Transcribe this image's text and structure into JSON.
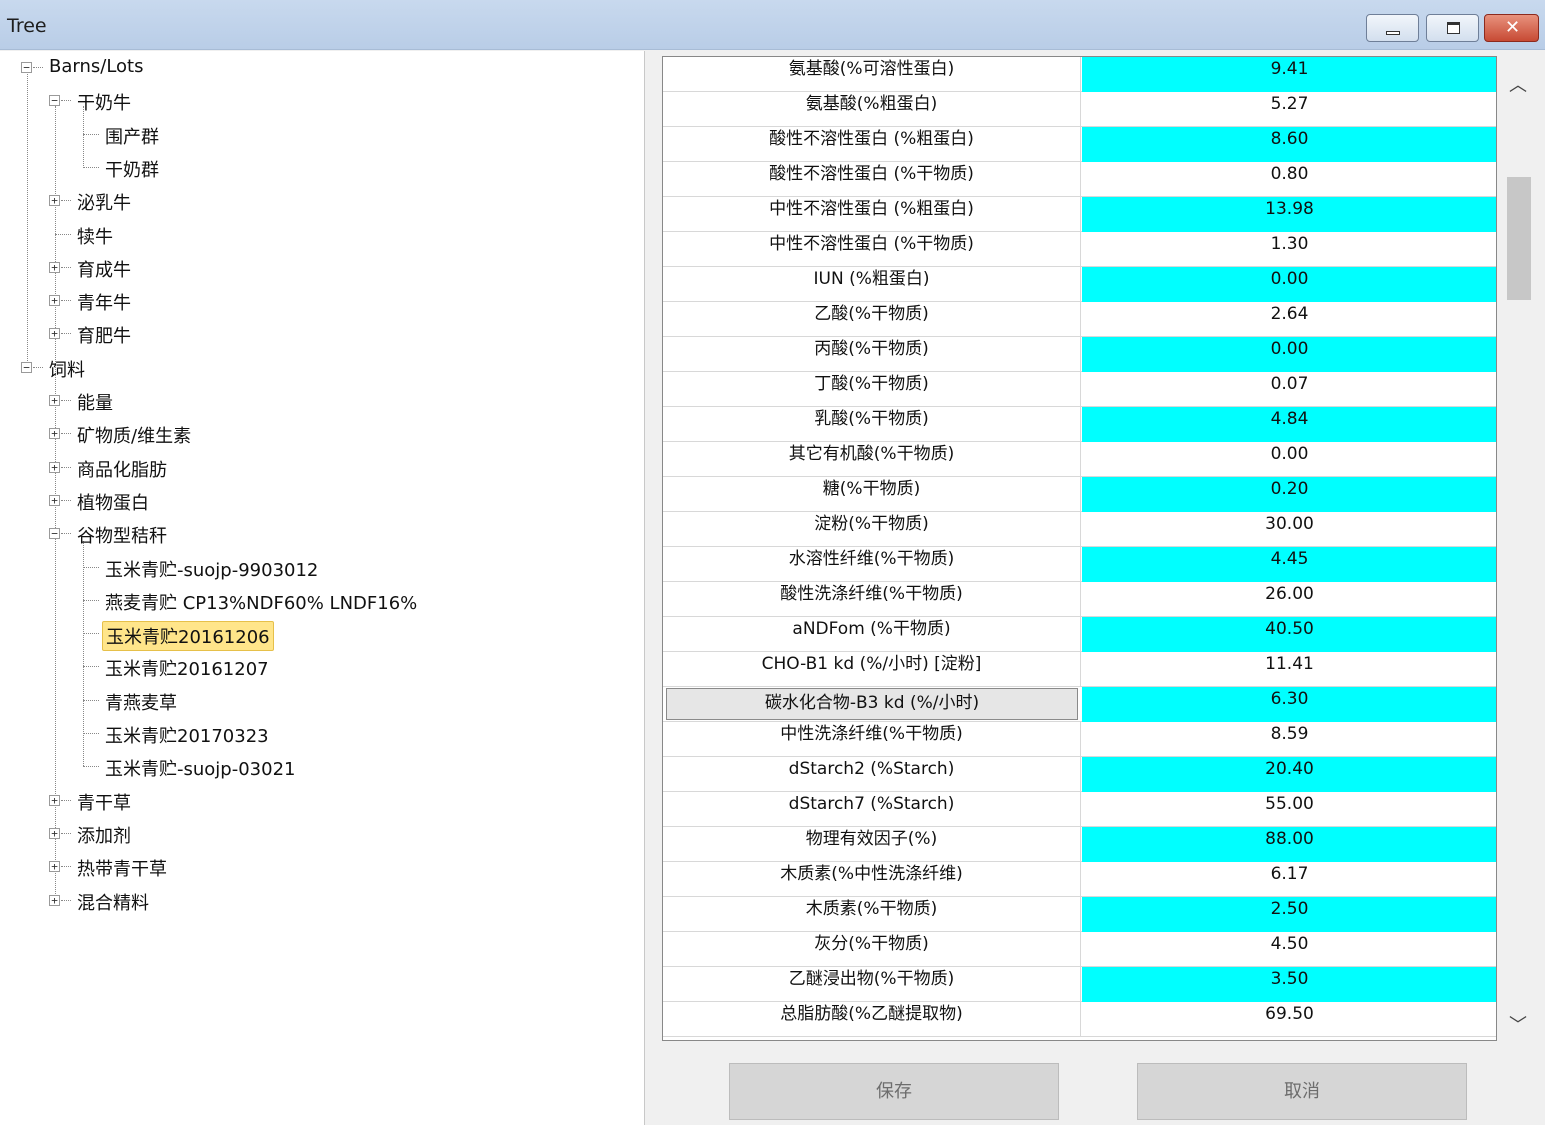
{
  "window": {
    "title": "Tree"
  },
  "tree": {
    "nodes": [
      {
        "label": "Barns/Lots",
        "expander": "−"
      },
      {
        "label": "干奶牛",
        "expander": "−"
      },
      {
        "label": "围产群"
      },
      {
        "label": "干奶群"
      },
      {
        "label": "泌乳牛",
        "expander": "+"
      },
      {
        "label": "犊牛"
      },
      {
        "label": "育成牛",
        "expander": "+"
      },
      {
        "label": "青年牛",
        "expander": "+"
      },
      {
        "label": "育肥牛",
        "expander": "+"
      },
      {
        "label": "饲料",
        "expander": "−"
      },
      {
        "label": "能量",
        "expander": "+"
      },
      {
        "label": "矿物质/维生素",
        "expander": "+"
      },
      {
        "label": "商品化脂肪",
        "expander": "+"
      },
      {
        "label": "植物蛋白",
        "expander": "+"
      },
      {
        "label": "谷物型秸秆",
        "expander": "−"
      },
      {
        "label": "玉米青贮-suojp-9903012"
      },
      {
        "label": "燕麦青贮 CP13%NDF60% LNDF16%"
      },
      {
        "label": "玉米青贮20161206",
        "selected": true
      },
      {
        "label": "玉米青贮20161207"
      },
      {
        "label": "青燕麦草"
      },
      {
        "label": "玉米青贮20170323"
      },
      {
        "label": "玉米青贮-suojp-03021"
      },
      {
        "label": "青干草",
        "expander": "+"
      },
      {
        "label": "添加剂",
        "expander": "+"
      },
      {
        "label": "热带青干草",
        "expander": "+"
      },
      {
        "label": "混合精料",
        "expander": "+"
      }
    ]
  },
  "grid": {
    "rows": [
      {
        "name": "氨基酸(%可溶性蛋白)",
        "value": "9.41",
        "highlight": true
      },
      {
        "name": "氨基酸(%粗蛋白)",
        "value": "5.27",
        "highlight": false
      },
      {
        "name": "酸性不溶性蛋白 (%粗蛋白)",
        "value": "8.60",
        "highlight": true
      },
      {
        "name": "酸性不溶性蛋白 (%干物质)",
        "value": "0.80",
        "highlight": false
      },
      {
        "name": "中性不溶性蛋白 (%粗蛋白)",
        "value": "13.98",
        "highlight": true
      },
      {
        "name": "中性不溶性蛋白 (%干物质)",
        "value": "1.30",
        "highlight": false
      },
      {
        "name": "IUN (%粗蛋白)",
        "value": "0.00",
        "highlight": true
      },
      {
        "name": "乙酸(%干物质)",
        "value": "2.64",
        "highlight": false
      },
      {
        "name": "丙酸(%干物质)",
        "value": "0.00",
        "highlight": true
      },
      {
        "name": "丁酸(%干物质)",
        "value": "0.07",
        "highlight": false
      },
      {
        "name": "乳酸(%干物质)",
        "value": "4.84",
        "highlight": true
      },
      {
        "name": "其它有机酸(%干物质)",
        "value": "0.00",
        "highlight": false
      },
      {
        "name": "糖(%干物质)",
        "value": "0.20",
        "highlight": true
      },
      {
        "name": "淀粉(%干物质)",
        "value": "30.00",
        "highlight": false
      },
      {
        "name": "水溶性纤维(%干物质)",
        "value": "4.45",
        "highlight": true
      },
      {
        "name": "酸性洗涤纤维(%干物质)",
        "value": "26.00",
        "highlight": false
      },
      {
        "name": "aNDFom (%干物质)",
        "value": "40.50",
        "highlight": true
      },
      {
        "name": "CHO-B1 kd (%/小时) [淀粉]",
        "value": "11.41",
        "highlight": false
      },
      {
        "name": "碳水化合物-B3 kd (%/小时)",
        "value": "6.30",
        "highlight": true,
        "focused": true
      },
      {
        "name": "中性洗涤纤维(%干物质)",
        "value": "8.59",
        "highlight": false
      },
      {
        "name": "dStarch2 (%Starch)",
        "value": "20.40",
        "highlight": true
      },
      {
        "name": "dStarch7 (%Starch)",
        "value": "55.00",
        "highlight": false
      },
      {
        "name": "物理有效因子(%)",
        "value": "88.00",
        "highlight": true
      },
      {
        "name": "木质素(%中性洗涤纤维)",
        "value": "6.17",
        "highlight": false
      },
      {
        "name": "木质素(%干物质)",
        "value": "2.50",
        "highlight": true
      },
      {
        "name": "灰分(%干物质)",
        "value": "4.50",
        "highlight": false
      },
      {
        "name": "乙醚浸出物(%干物质)",
        "value": "3.50",
        "highlight": true
      },
      {
        "name": "总脂肪酸(%乙醚提取物)",
        "value": "69.50",
        "highlight": false
      }
    ]
  },
  "buttons": {
    "save": "保存",
    "cancel": "取消"
  },
  "colors": {
    "highlight": "#00ffff",
    "selected": "#ffe58a"
  }
}
